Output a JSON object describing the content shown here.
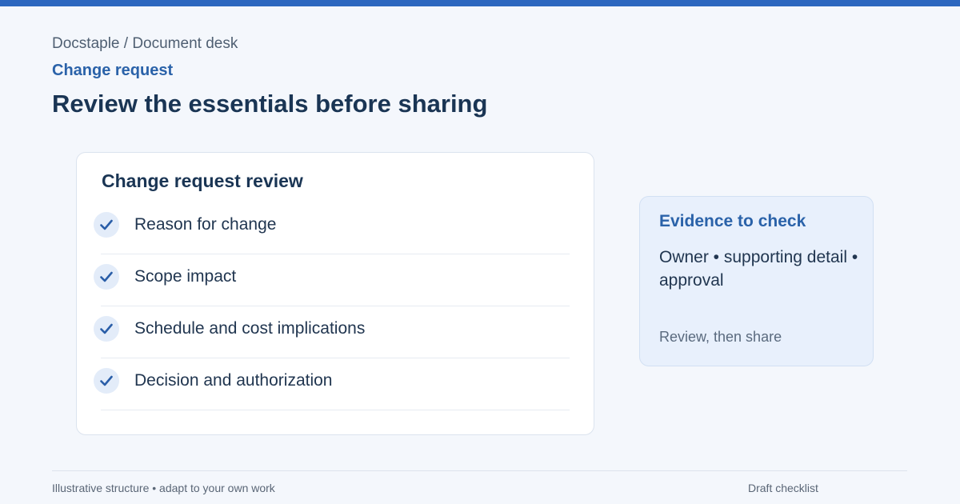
{
  "header": {
    "breadcrumb": "Docstaple / Document desk",
    "eyebrow": "Change request",
    "title": "Review the essentials before sharing"
  },
  "checklist": {
    "title": "Change request review",
    "items": [
      {
        "label": "Reason for change",
        "checked": true,
        "icon": "check-icon"
      },
      {
        "label": "Scope impact",
        "checked": true,
        "icon": "check-icon"
      },
      {
        "label": "Schedule and cost implications",
        "checked": true,
        "icon": "check-icon"
      },
      {
        "label": "Decision and authorization",
        "checked": true,
        "icon": "check-icon"
      }
    ]
  },
  "evidence": {
    "title": "Evidence to check",
    "body": "Owner • supporting detail • approval",
    "footer": "Review, then share"
  },
  "footer": {
    "left": "Illustrative structure • adapt to your own work",
    "right": "Draft checklist"
  },
  "colors": {
    "accent": "#2c67bf",
    "background": "#f4f7fc",
    "heading": "#1a3554",
    "check_bg": "#e3ecf9",
    "evidence_bg": "#e8f0fc"
  }
}
